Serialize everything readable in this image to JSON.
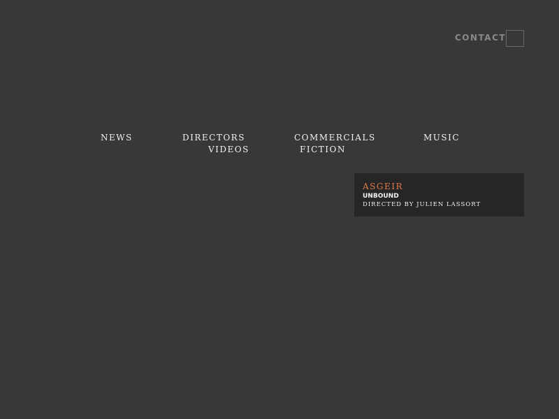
{
  "header": {
    "contact_label": "CONTACT"
  },
  "nav": {
    "items": [
      {
        "label": "NEWS"
      },
      {
        "label": "DIRECTORS"
      },
      {
        "label": "COMMERCIALS"
      },
      {
        "label": "MUSIC"
      },
      {
        "label": "VIDEOS"
      },
      {
        "label": "FICTION"
      }
    ]
  },
  "featured": {
    "title": "ASGEIR",
    "subtitle": "UNBOUND",
    "credit": "DIRECTED BY JULIEN LASSORT",
    "accent_color": "#e07b4a"
  }
}
